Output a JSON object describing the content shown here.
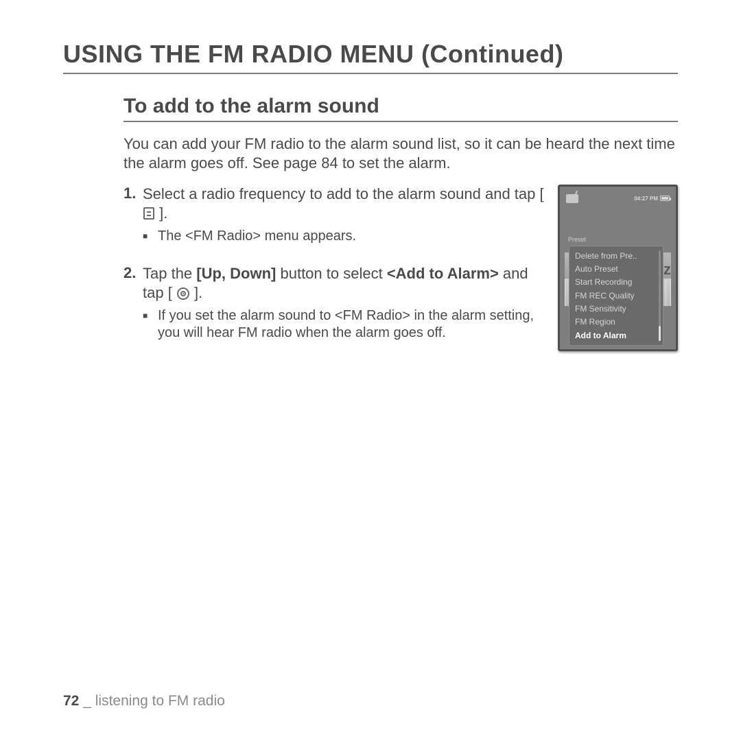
{
  "title": "USING THE FM RADIO MENU (Continued)",
  "section_heading": "To add to the alarm sound",
  "intro": "You can add your FM radio to the alarm sound list, so it can be heard the next time the alarm goes off. See page 84 to set the alarm.",
  "steps": {
    "s1": {
      "num": "1.",
      "text_a": "Select a radio frequency to add to the alarm sound and tap ",
      "bracket_open": "[ ",
      "bracket_close": " ]",
      "period": ".",
      "sub": "The <FM Radio> menu appears."
    },
    "s2": {
      "num": "2.",
      "text_a": "Tap the ",
      "bold_a": "[Up, Down]",
      "text_b": " button to select ",
      "bold_b": "<Add to Alarm>",
      "text_c": " and tap ",
      "bracket_open": "[ ",
      "bracket_close": " ]",
      "period": ".",
      "sub": "If you set the alarm sound to <FM Radio> in the alarm setting, you will hear FM radio when the alarm goes off."
    }
  },
  "device": {
    "time": "04:27 PM",
    "preset_label": "Preset",
    "hz": "Iz",
    "menu": [
      "Delete from Pre..",
      "Auto Preset",
      "Start Recording",
      "FM REC Quality",
      "FM Sensitivity",
      "FM Region",
      "Add to Alarm"
    ],
    "selected_index": 6
  },
  "footer": {
    "page": "72",
    "sep": "_",
    "title": "listening to FM radio"
  }
}
